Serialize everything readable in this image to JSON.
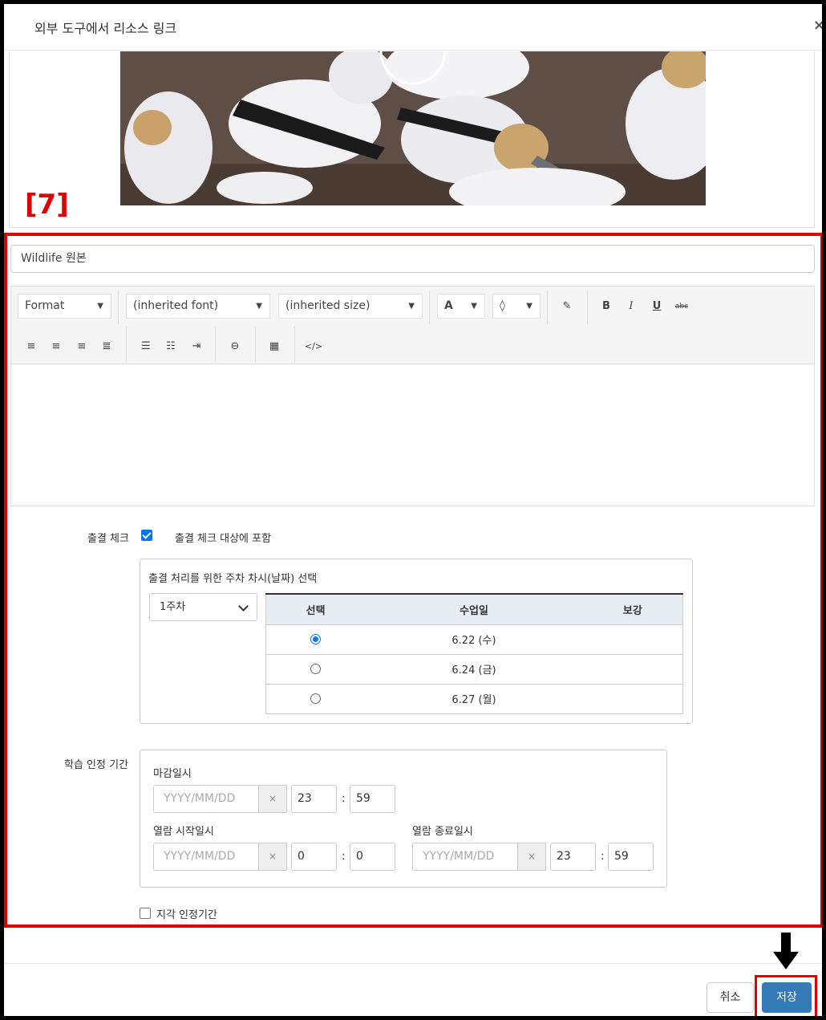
{
  "dialog": {
    "title": "외부 도구에서 리소스 링크",
    "close_icon": "×"
  },
  "annotation": {
    "step_marker": "[7]",
    "highlight_color": "#e00000"
  },
  "resource_title": {
    "value": "Wildlife 원본"
  },
  "editor": {
    "format_label": "Format",
    "font_label": "(inherited font)",
    "size_label": "(inherited size)",
    "text_color_label": "A",
    "bold": "B",
    "italic": "I",
    "underline": "U",
    "strike": "abc",
    "code": "</>"
  },
  "attendance": {
    "label": "출결 체크",
    "checked": true,
    "include_label": "출결 체크 대상에 포함",
    "session_heading": "출결 처리를 위한 주차 차시(날짜) 선택",
    "week_selected": "1주차",
    "table": {
      "headers": [
        "선택",
        "수업일",
        "보강"
      ],
      "rows": [
        {
          "selected": true,
          "date": "6.22 (수)",
          "makeup": ""
        },
        {
          "selected": false,
          "date": "6.24 (금)",
          "makeup": ""
        },
        {
          "selected": false,
          "date": "6.27 (월)",
          "makeup": ""
        }
      ]
    }
  },
  "period": {
    "label": "학습 인정 기간",
    "deadline_label": "마감일시",
    "deadline": {
      "date_placeholder": "YYYY/MM/DD",
      "hour": "23",
      "minute": "59"
    },
    "open_start_label": "열람 시작일시",
    "open_start": {
      "date_placeholder": "YYYY/MM/DD",
      "hour": "0",
      "minute": "0"
    },
    "open_end_label": "열람 종료일시",
    "open_end": {
      "date_placeholder": "YYYY/MM/DD",
      "hour": "23",
      "minute": "59"
    },
    "clear_icon": "×",
    "colon": ":"
  },
  "late": {
    "label": "지각 인정기간",
    "checked": false
  },
  "footer": {
    "cancel_label": "취소",
    "save_label": "저장"
  }
}
